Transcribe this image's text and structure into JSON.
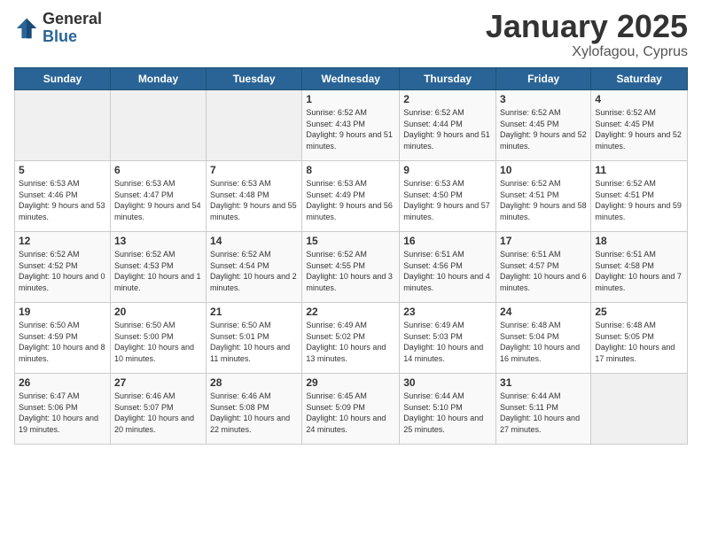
{
  "logo": {
    "general": "General",
    "blue": "Blue"
  },
  "header": {
    "month": "January 2025",
    "location": "Xylofagou, Cyprus"
  },
  "days_of_week": [
    "Sunday",
    "Monday",
    "Tuesday",
    "Wednesday",
    "Thursday",
    "Friday",
    "Saturday"
  ],
  "weeks": [
    [
      {
        "day": "",
        "info": ""
      },
      {
        "day": "",
        "info": ""
      },
      {
        "day": "",
        "info": ""
      },
      {
        "day": "1",
        "info": "Sunrise: 6:52 AM\nSunset: 4:43 PM\nDaylight: 9 hours and 51 minutes."
      },
      {
        "day": "2",
        "info": "Sunrise: 6:52 AM\nSunset: 4:44 PM\nDaylight: 9 hours and 51 minutes."
      },
      {
        "day": "3",
        "info": "Sunrise: 6:52 AM\nSunset: 4:45 PM\nDaylight: 9 hours and 52 minutes."
      },
      {
        "day": "4",
        "info": "Sunrise: 6:52 AM\nSunset: 4:45 PM\nDaylight: 9 hours and 52 minutes."
      }
    ],
    [
      {
        "day": "5",
        "info": "Sunrise: 6:53 AM\nSunset: 4:46 PM\nDaylight: 9 hours and 53 minutes."
      },
      {
        "day": "6",
        "info": "Sunrise: 6:53 AM\nSunset: 4:47 PM\nDaylight: 9 hours and 54 minutes."
      },
      {
        "day": "7",
        "info": "Sunrise: 6:53 AM\nSunset: 4:48 PM\nDaylight: 9 hours and 55 minutes."
      },
      {
        "day": "8",
        "info": "Sunrise: 6:53 AM\nSunset: 4:49 PM\nDaylight: 9 hours and 56 minutes."
      },
      {
        "day": "9",
        "info": "Sunrise: 6:53 AM\nSunset: 4:50 PM\nDaylight: 9 hours and 57 minutes."
      },
      {
        "day": "10",
        "info": "Sunrise: 6:52 AM\nSunset: 4:51 PM\nDaylight: 9 hours and 58 minutes."
      },
      {
        "day": "11",
        "info": "Sunrise: 6:52 AM\nSunset: 4:51 PM\nDaylight: 9 hours and 59 minutes."
      }
    ],
    [
      {
        "day": "12",
        "info": "Sunrise: 6:52 AM\nSunset: 4:52 PM\nDaylight: 10 hours and 0 minutes."
      },
      {
        "day": "13",
        "info": "Sunrise: 6:52 AM\nSunset: 4:53 PM\nDaylight: 10 hours and 1 minute."
      },
      {
        "day": "14",
        "info": "Sunrise: 6:52 AM\nSunset: 4:54 PM\nDaylight: 10 hours and 2 minutes."
      },
      {
        "day": "15",
        "info": "Sunrise: 6:52 AM\nSunset: 4:55 PM\nDaylight: 10 hours and 3 minutes."
      },
      {
        "day": "16",
        "info": "Sunrise: 6:51 AM\nSunset: 4:56 PM\nDaylight: 10 hours and 4 minutes."
      },
      {
        "day": "17",
        "info": "Sunrise: 6:51 AM\nSunset: 4:57 PM\nDaylight: 10 hours and 6 minutes."
      },
      {
        "day": "18",
        "info": "Sunrise: 6:51 AM\nSunset: 4:58 PM\nDaylight: 10 hours and 7 minutes."
      }
    ],
    [
      {
        "day": "19",
        "info": "Sunrise: 6:50 AM\nSunset: 4:59 PM\nDaylight: 10 hours and 8 minutes."
      },
      {
        "day": "20",
        "info": "Sunrise: 6:50 AM\nSunset: 5:00 PM\nDaylight: 10 hours and 10 minutes."
      },
      {
        "day": "21",
        "info": "Sunrise: 6:50 AM\nSunset: 5:01 PM\nDaylight: 10 hours and 11 minutes."
      },
      {
        "day": "22",
        "info": "Sunrise: 6:49 AM\nSunset: 5:02 PM\nDaylight: 10 hours and 13 minutes."
      },
      {
        "day": "23",
        "info": "Sunrise: 6:49 AM\nSunset: 5:03 PM\nDaylight: 10 hours and 14 minutes."
      },
      {
        "day": "24",
        "info": "Sunrise: 6:48 AM\nSunset: 5:04 PM\nDaylight: 10 hours and 16 minutes."
      },
      {
        "day": "25",
        "info": "Sunrise: 6:48 AM\nSunset: 5:05 PM\nDaylight: 10 hours and 17 minutes."
      }
    ],
    [
      {
        "day": "26",
        "info": "Sunrise: 6:47 AM\nSunset: 5:06 PM\nDaylight: 10 hours and 19 minutes."
      },
      {
        "day": "27",
        "info": "Sunrise: 6:46 AM\nSunset: 5:07 PM\nDaylight: 10 hours and 20 minutes."
      },
      {
        "day": "28",
        "info": "Sunrise: 6:46 AM\nSunset: 5:08 PM\nDaylight: 10 hours and 22 minutes."
      },
      {
        "day": "29",
        "info": "Sunrise: 6:45 AM\nSunset: 5:09 PM\nDaylight: 10 hours and 24 minutes."
      },
      {
        "day": "30",
        "info": "Sunrise: 6:44 AM\nSunset: 5:10 PM\nDaylight: 10 hours and 25 minutes."
      },
      {
        "day": "31",
        "info": "Sunrise: 6:44 AM\nSunset: 5:11 PM\nDaylight: 10 hours and 27 minutes."
      },
      {
        "day": "",
        "info": ""
      }
    ]
  ]
}
